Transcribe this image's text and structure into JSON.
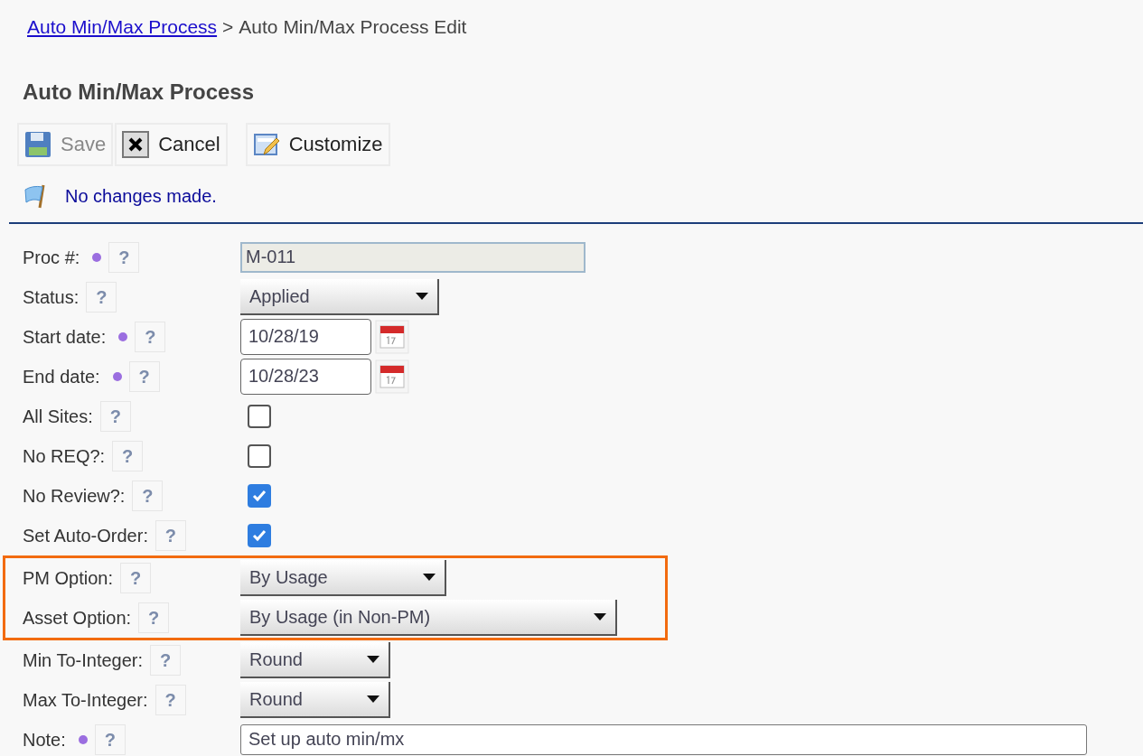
{
  "breadcrumb": {
    "link": "Auto Min/Max Process",
    "separator": ">",
    "current": "Auto Min/Max Process Edit"
  },
  "title": "Auto Min/Max Process",
  "toolbar": [
    {
      "kind": "save",
      "label": "Save",
      "disabled": true
    },
    {
      "kind": "cancel",
      "label": "Cancel",
      "disabled": false
    },
    {
      "kind": "customize",
      "label": "Customize",
      "disabled": false
    }
  ],
  "message": "No changes made.",
  "fields": [
    {
      "label": "Proc #:",
      "required": true,
      "help": "?",
      "kind": "readonly",
      "value": "M-011",
      "highlighted": false
    },
    {
      "label": "Status:",
      "required": false,
      "help": "?",
      "kind": "select",
      "value": "Applied",
      "highlighted": false
    },
    {
      "label": "Start date:",
      "required": true,
      "help": "?",
      "kind": "date",
      "value": "10/28/19",
      "highlighted": false
    },
    {
      "label": "End date:",
      "required": true,
      "help": "?",
      "kind": "date",
      "value": "10/28/23",
      "highlighted": false
    },
    {
      "label": "All Sites:",
      "required": false,
      "help": "?",
      "kind": "checkbox",
      "checked": false,
      "highlighted": false
    },
    {
      "label": "No REQ?:",
      "required": false,
      "help": "?",
      "kind": "checkbox",
      "checked": false,
      "highlighted": false
    },
    {
      "label": "No Review?:",
      "required": false,
      "help": "?",
      "kind": "checkbox",
      "checked": true,
      "highlighted": false
    },
    {
      "label": "Set Auto-Order:",
      "required": false,
      "help": "?",
      "kind": "checkbox",
      "checked": true,
      "highlighted": false
    },
    {
      "label": "PM Option:",
      "required": false,
      "help": "?",
      "kind": "select",
      "value": "By Usage",
      "highlighted": true
    },
    {
      "label": "Asset Option:",
      "required": false,
      "help": "?",
      "kind": "select",
      "value": "By Usage (in Non-PM)",
      "highlighted": true
    },
    {
      "label": "Min To-Integer:",
      "required": false,
      "help": "?",
      "kind": "select",
      "value": "Round",
      "highlighted": false
    },
    {
      "label": "Max To-Integer:",
      "required": false,
      "help": "?",
      "kind": "select",
      "value": "Round",
      "highlighted": false
    },
    {
      "label": "Note:",
      "required": true,
      "help": "?",
      "kind": "text",
      "value": "Set up auto min/mx",
      "highlighted": false
    }
  ]
}
